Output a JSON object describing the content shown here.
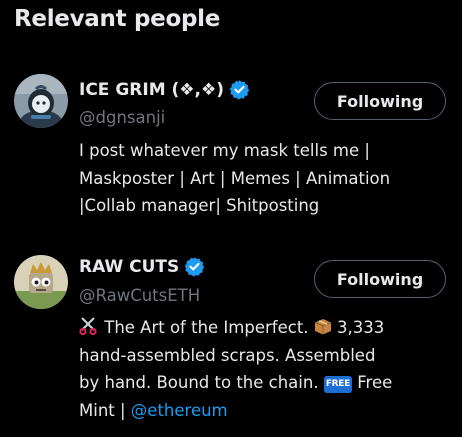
{
  "section": {
    "title": "Relevant people"
  },
  "people": [
    {
      "name": "ICE GRIM (❖,❖)",
      "handle": "@dgnsanji",
      "follow_label": "Following",
      "bio_lines": [
        "I post whatever my mask tells me |",
        "Maskposter | Art | Memes | Animation",
        "|Collab manager| Shitposting"
      ],
      "avatar_icon": "masked-character-avatar"
    },
    {
      "name": "RAW CUTS",
      "handle": "@RawCutsETH",
      "follow_label": "Following",
      "bio": {
        "part1": " The Art of the Imperfect. ",
        "part2": " 3,333",
        "line2": "hand-assembled scraps. Assembled",
        "line3a": "by hand. Bound to the chain. ",
        "line3b": " Free",
        "line4a": "Mint | ",
        "mention": "@ethereum",
        "free_badge": "FREE"
      },
      "avatar_icon": "crowned-character-avatar"
    }
  ],
  "colors": {
    "background": "#000000",
    "text_primary": "#e7e9ea",
    "text_secondary": "#71767b",
    "accent": "#1d9bf0",
    "button_border": "#536471"
  }
}
